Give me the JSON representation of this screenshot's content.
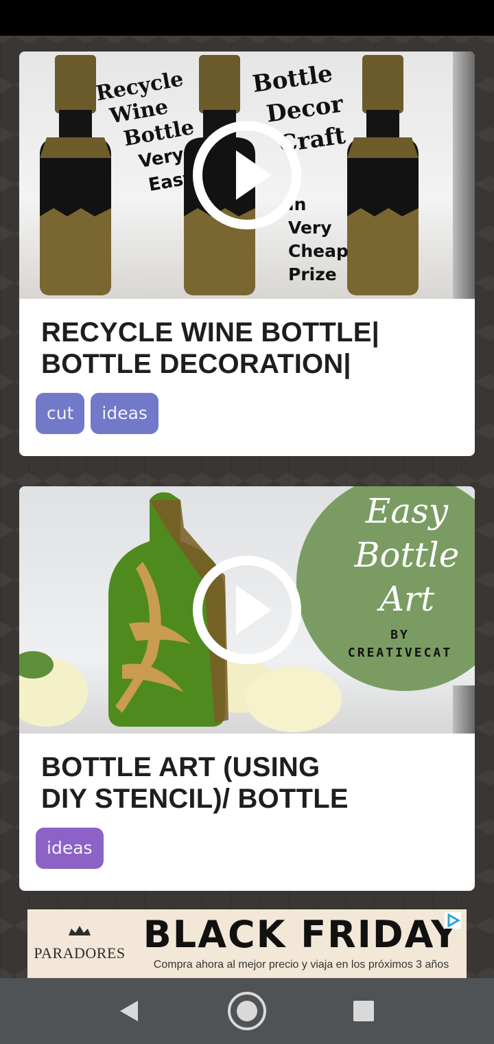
{
  "videos": [
    {
      "title_line1": "RECYCLE WINE BOTTLE|",
      "title_line2": "BOTTLE DECORATION|",
      "thumb_text_left": [
        "Recycle",
        "Wine",
        "Bottle",
        "Very",
        "Easy"
      ],
      "thumb_text_right": [
        "Bottle",
        "Decor",
        "Craft",
        "in",
        "Very",
        "Cheap",
        "Prize"
      ],
      "tags": [
        "cut",
        "ideas"
      ],
      "tag_color": "#7279c8"
    },
    {
      "title_line1": "BOTTLE ART (USING",
      "title_line2": "DIY STENCIL)/ BOTTLE",
      "thumb_text": [
        "Easy",
        "Bottle",
        "Art",
        "BY",
        "CREATIVECAT"
      ],
      "tags": [
        "ideas"
      ],
      "tag_color": "#8c62c7"
    }
  ],
  "ad": {
    "brand": "PARADORES",
    "headline": "BLACK FRIDAY",
    "subtext": "Compra ahora al mejor precio y viaja en los próximos 3 años",
    "adchoices_icon": "adchoices-icon"
  },
  "colors": {
    "status_bar": "#000000",
    "nav_bar": "#505355",
    "background": "#3a3634",
    "circle_green": "#7a9c62"
  },
  "nav": {
    "back_icon": "back-triangle-icon",
    "home_icon": "home-circle-icon",
    "recents_icon": "recents-square-icon"
  }
}
